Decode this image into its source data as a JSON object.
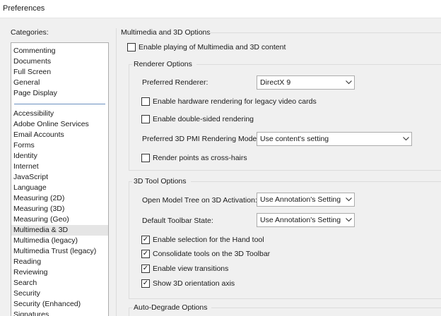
{
  "window": {
    "title": "Preferences"
  },
  "categories": {
    "label": "Categories:",
    "top_items": [
      "Commenting",
      "Documents",
      "Full Screen",
      "General",
      "Page Display"
    ],
    "items": [
      "Accessibility",
      "Adobe Online Services",
      "Email Accounts",
      "Forms",
      "Identity",
      "Internet",
      "JavaScript",
      "Language",
      "Measuring (2D)",
      "Measuring (3D)",
      "Measuring (Geo)",
      "Multimedia & 3D",
      "Multimedia (legacy)",
      "Multimedia Trust (legacy)",
      "Reading",
      "Reviewing",
      "Search",
      "Security",
      "Security (Enhanced)",
      "Signatures"
    ],
    "selected": "Multimedia & 3D"
  },
  "main": {
    "section_title": "Multimedia and 3D Options",
    "enable_playing": {
      "label": "Enable playing of Multimedia and 3D content",
      "checked": false
    },
    "renderer": {
      "title": "Renderer Options",
      "preferred_renderer_label": "Preferred Renderer:",
      "preferred_renderer_value": "DirectX 9",
      "hw_rendering": {
        "label": "Enable hardware rendering for legacy video cards",
        "checked": false
      },
      "double_sided": {
        "label": "Enable double-sided rendering",
        "checked": false
      },
      "pmi_label": "Preferred 3D PMI Rendering Mode:",
      "pmi_value": "Use content's setting",
      "cross_hairs": {
        "label": "Render points as cross-hairs",
        "checked": false
      }
    },
    "tool": {
      "title": "3D Tool Options",
      "model_tree_label": "Open Model Tree on 3D Activation:",
      "model_tree_value": "Use Annotation's Setting",
      "toolbar_state_label": "Default Toolbar State:",
      "toolbar_state_value": "Use Annotation's Setting",
      "hand_tool": {
        "label": "Enable selection for the Hand tool",
        "checked": true
      },
      "consolidate": {
        "label": "Consolidate tools on the 3D Toolbar",
        "checked": true
      },
      "view_transitions": {
        "label": "Enable view transitions",
        "checked": true
      },
      "orientation_axis": {
        "label": "Show 3D orientation axis",
        "checked": true
      }
    },
    "auto_degrade": {
      "title": "Auto-Degrade Options"
    }
  },
  "icons": {
    "checkmark": "✓",
    "chevron": "chevron-down-icon"
  }
}
